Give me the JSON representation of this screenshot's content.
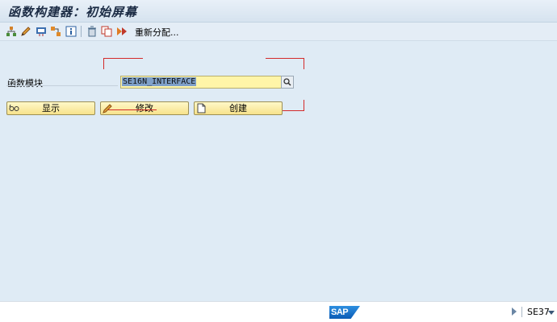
{
  "window": {
    "title": "函数构建器：初始屏幕"
  },
  "toolbar": {
    "icons": [
      "hierarchy-icon",
      "pencil-icon",
      "display-object-icon",
      "where-used-icon",
      "info-icon",
      "trash-icon",
      "copy-icon",
      "rename-icon"
    ],
    "reassign_label": "重新分配..."
  },
  "form": {
    "field_label": "函数模块",
    "field_value": "SE16N_INTERFACE"
  },
  "buttons": {
    "display": "显示",
    "change": "修改",
    "create": "创建"
  },
  "footer": {
    "logo_text": "SAP",
    "transaction_code": "SE37"
  },
  "colors": {
    "background": "#dfebf5",
    "input_bg": "#fff5a8",
    "button_bg": "#f7e28b",
    "annotation_red": "#d32a2a",
    "sap_blue": "#0b5bb5"
  }
}
